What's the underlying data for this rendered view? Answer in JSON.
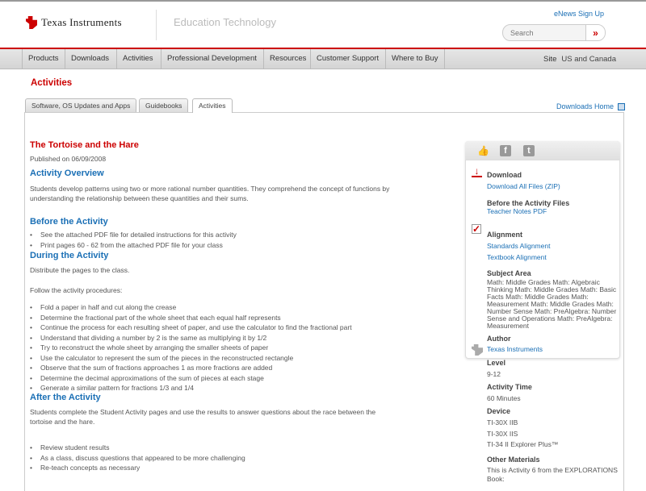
{
  "header": {
    "logo": "Texas Instruments",
    "section": "Education Technology",
    "enews": "eNews Sign Up",
    "search_placeholder": "Search",
    "search_button": "»"
  },
  "nav": {
    "items": [
      "Products",
      "Downloads",
      "Activities",
      "Professional Development",
      "Resources",
      "Customer Support",
      "Where to Buy"
    ],
    "site_label": "Site",
    "site_value": "US and Canada"
  },
  "page_heading": "Activities",
  "tabs": [
    "Software, OS Updates and Apps",
    "Guidebooks",
    "Activities"
  ],
  "downloads_home": "Downloads Home",
  "main": {
    "title": "The Tortoise and the Hare",
    "published": "Published on 06/09/2008",
    "overview_h": "Activity Overview",
    "overview": [
      "Students develop patterns using two or more rational number quantities. They comprehend the concept of functions by",
      "understanding the relationship between these quantities and their sums."
    ],
    "before_h": "Before the Activity",
    "before": [
      "See the attached PDF file for detailed instructions for this activity",
      "Print pages 60 - 62 from the attached PDF file for your class"
    ],
    "during_h": "During the Activity",
    "during_p1": "Distribute the pages to the class.",
    "during_p2": "Follow the activity procedures:",
    "during": [
      "Fold a paper in half and cut along the crease",
      "Determine the fractional part of the whole sheet that each equal half represents",
      "Continue the process for each resulting sheet of paper, and use the calculator to find the fractional part",
      "Understand that dividing a number by 2 is the same as multiplying it by 1/2",
      "Try to reconstruct the whole sheet by arranging the smaller sheets of paper",
      "Use the calculator to represent the sum of the pieces in the reconstructed rectangle",
      "Observe that the sum of fractions approaches 1 as more fractions are added",
      "Determine the decimal approximations of the sum of pieces at each stage",
      "Generate a similar pattern for fractions 1/3 and 1/4"
    ],
    "after_h": "After the Activity",
    "after": [
      "Students complete the Student Activity pages and use the results to answer questions about the race between the",
      "tortoise and the hare."
    ],
    "after_list": [
      "Review student results",
      "As a class, discuss questions that appeared to be more challenging",
      "Re-teach concepts as necessary"
    ]
  },
  "sidebar": {
    "download_h": "Download",
    "download_all": "Download All Files (ZIP)",
    "before_files_h": "Before the Activity Files",
    "teacher_notes": "Teacher Notes PDF",
    "alignment_h": "Alignment",
    "standards": "Standards Alignment",
    "textbook": "Textbook Alignment",
    "subject_h": "Subject Area",
    "subjects": "Math: Middle Grades Math: Algebraic Thinking Math: Middle Grades Math: Basic Facts Math: Middle Grades Math: Measurement Math: Middle Grades Math: Number Sense Math: PreAlgebra: Number Sense and Operations Math: PreAlgebra: Measurement",
    "author_h": "Author",
    "author": "Texas Instruments",
    "level_h": "Level",
    "level": "9-12",
    "time_h": "Activity Time",
    "time": "60 Minutes",
    "device_h": "Device",
    "devices": [
      "TI-30X IIB",
      "TI-30X IIS",
      "TI-34 II Explorer Plus™"
    ],
    "other_h": "Other Materials",
    "other": "This is Activity 6 from the EXPLORATIONS Book:"
  }
}
